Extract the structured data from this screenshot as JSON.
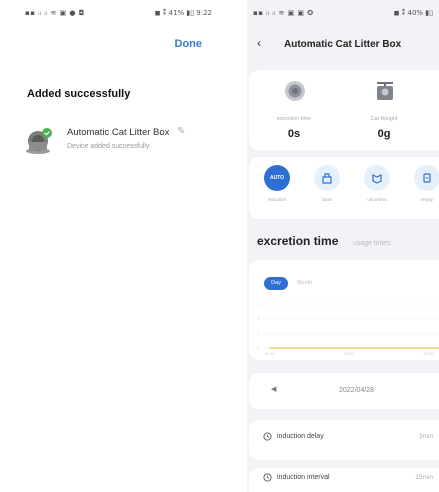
{
  "left": {
    "status_left": "▪▪ ᵢₗ ᵢₗ ≋ ▣ ● ◘",
    "status_right": "◼ ⁑ 41% ▮▯ 9:22",
    "done_label": "Done",
    "added_title": "Added successfully",
    "device_name": "Automatic Cat Litter Box",
    "device_status": "Device added successfully"
  },
  "right": {
    "status_left": "▪▪ ᵢₗ ᵢₗ ≋ ▣ ▣ ✪",
    "status_right": "◼ ⁑ 40% ▮▯",
    "nav_title": "Automatic Cat Litter Box",
    "stats": [
      {
        "label": "excretion time",
        "value": "0s",
        "icon": "clock-icon"
      },
      {
        "label": "Cat Weight",
        "value": "0g",
        "icon": "scale-icon"
      }
    ],
    "actions": [
      {
        "label": "induction",
        "icon_text": "AUTO",
        "active": true
      },
      {
        "label": "clean",
        "icon": "clean-icon",
        "active": false
      },
      {
        "label": "odourless",
        "icon": "odourless-icon",
        "active": false
      },
      {
        "label": "empty",
        "icon": "empty-icon",
        "active": false
      }
    ],
    "tabs": {
      "active": "excretion time",
      "inactive": "usage times"
    },
    "chart": {
      "range_active": "Day",
      "range_inactive": "Month",
      "y_ticks": [
        "3",
        "2",
        "1",
        "0"
      ],
      "x_ticks": [
        "00:00",
        "06:00",
        "12:00"
      ]
    },
    "chart_data": {
      "type": "line",
      "x": [
        "00:00",
        "06:00",
        "12:00"
      ],
      "series": [
        {
          "values": [
            0,
            0,
            0
          ]
        }
      ],
      "ylim": [
        0,
        3
      ]
    },
    "date": "2022/04/28",
    "settings": [
      {
        "label": "induction delay",
        "value": "3min"
      },
      {
        "label": "induction interval",
        "value": "15min"
      }
    ],
    "colors": {
      "accent": "#2f6fd3",
      "line": "#f2b233",
      "link": "#3a7bd5"
    }
  }
}
